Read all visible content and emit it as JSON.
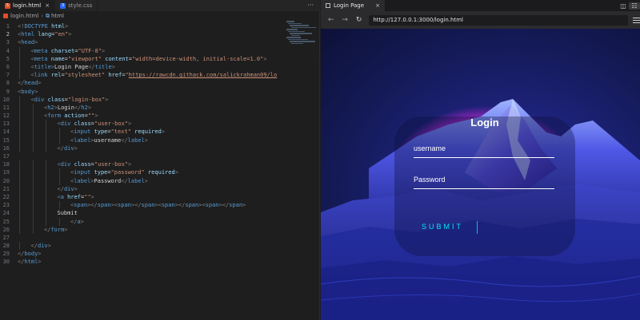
{
  "editor": {
    "tabs": [
      {
        "label": "login.html",
        "icon": "html-file-icon",
        "close": "×"
      },
      {
        "label": "style.css",
        "icon": "css-file-icon",
        "close": ""
      }
    ],
    "more": "···",
    "breadcrumb": {
      "file": "login.html",
      "separator": "›",
      "node": "html"
    },
    "current_line": 2,
    "lines": [
      {
        "n": "1",
        "indent": 0,
        "tokens": [
          [
            "br",
            "<!"
          ],
          [
            "tag",
            "DOCTYPE"
          ],
          [
            "text",
            " "
          ],
          [
            "attr",
            "html"
          ],
          [
            "br",
            ">"
          ]
        ]
      },
      {
        "n": "2",
        "indent": 0,
        "tokens": [
          [
            "br",
            "<"
          ],
          [
            "tag",
            "html"
          ],
          [
            "text",
            " "
          ],
          [
            "attr",
            "lang"
          ],
          [
            "text",
            "="
          ],
          [
            "str",
            "\"en\""
          ],
          [
            "br",
            ">"
          ]
        ]
      },
      {
        "n": "3",
        "indent": 0,
        "tokens": [
          [
            "br",
            "<"
          ],
          [
            "tag",
            "head"
          ],
          [
            "br",
            ">"
          ]
        ]
      },
      {
        "n": "4",
        "indent": 1,
        "tokens": [
          [
            "br",
            "<"
          ],
          [
            "tag",
            "meta"
          ],
          [
            "text",
            " "
          ],
          [
            "attr",
            "charset"
          ],
          [
            "text",
            "="
          ],
          [
            "str",
            "\"UTF-8\""
          ],
          [
            "br",
            ">"
          ]
        ]
      },
      {
        "n": "5",
        "indent": 1,
        "tokens": [
          [
            "br",
            "<"
          ],
          [
            "tag",
            "meta"
          ],
          [
            "text",
            " "
          ],
          [
            "attr",
            "name"
          ],
          [
            "text",
            "="
          ],
          [
            "str",
            "\"viewport\""
          ],
          [
            "text",
            " "
          ],
          [
            "attr",
            "content"
          ],
          [
            "text",
            "="
          ],
          [
            "str",
            "\"width=device-width, initial-scale=1.0\""
          ],
          [
            "br",
            ">"
          ]
        ]
      },
      {
        "n": "6",
        "indent": 1,
        "tokens": [
          [
            "br",
            "<"
          ],
          [
            "tag",
            "title"
          ],
          [
            "br",
            ">"
          ],
          [
            "text",
            "Login Page"
          ],
          [
            "br",
            "</"
          ],
          [
            "tag",
            "title"
          ],
          [
            "br",
            ">"
          ]
        ]
      },
      {
        "n": "7",
        "indent": 1,
        "tokens": [
          [
            "br",
            "<"
          ],
          [
            "tag",
            "link"
          ],
          [
            "text",
            " "
          ],
          [
            "attr",
            "rel"
          ],
          [
            "text",
            "="
          ],
          [
            "str",
            "\"stylesheet\""
          ],
          [
            "text",
            " "
          ],
          [
            "attr",
            "href"
          ],
          [
            "text",
            "="
          ],
          [
            "str",
            "\""
          ],
          [
            "url",
            "https://rawcdn.githack.com/salickrahman09/lo"
          ]
        ]
      },
      {
        "n": "8",
        "indent": 0,
        "tokens": [
          [
            "br",
            "</"
          ],
          [
            "tag",
            "head"
          ],
          [
            "br",
            ">"
          ]
        ]
      },
      {
        "n": "9",
        "indent": 0,
        "tokens": [
          [
            "br",
            "<"
          ],
          [
            "tag",
            "body"
          ],
          [
            "br",
            ">"
          ]
        ]
      },
      {
        "n": "10",
        "indent": 1,
        "tokens": [
          [
            "br",
            "<"
          ],
          [
            "tag",
            "div"
          ],
          [
            "text",
            " "
          ],
          [
            "attr",
            "class"
          ],
          [
            "text",
            "="
          ],
          [
            "str",
            "\"login-box\""
          ],
          [
            "br",
            ">"
          ]
        ]
      },
      {
        "n": "11",
        "indent": 2,
        "tokens": [
          [
            "br",
            "<"
          ],
          [
            "tag",
            "h2"
          ],
          [
            "br",
            ">"
          ],
          [
            "text",
            "Login"
          ],
          [
            "br",
            "</"
          ],
          [
            "tag",
            "h2"
          ],
          [
            "br",
            ">"
          ]
        ]
      },
      {
        "n": "12",
        "indent": 2,
        "tokens": [
          [
            "br",
            "<"
          ],
          [
            "tag",
            "form"
          ],
          [
            "text",
            " "
          ],
          [
            "attr",
            "action"
          ],
          [
            "text",
            "="
          ],
          [
            "str",
            "\"\""
          ],
          [
            "br",
            ">"
          ]
        ]
      },
      {
        "n": "13",
        "indent": 3,
        "tokens": [
          [
            "br",
            "<"
          ],
          [
            "tag",
            "div"
          ],
          [
            "text",
            " "
          ],
          [
            "attr",
            "class"
          ],
          [
            "text",
            "="
          ],
          [
            "str",
            "\"user-box\""
          ],
          [
            "br",
            ">"
          ]
        ]
      },
      {
        "n": "14",
        "indent": 4,
        "tokens": [
          [
            "br",
            "<"
          ],
          [
            "tag",
            "input"
          ],
          [
            "text",
            " "
          ],
          [
            "attr",
            "type"
          ],
          [
            "text",
            "="
          ],
          [
            "str",
            "\"text\""
          ],
          [
            "text",
            " "
          ],
          [
            "attr",
            "required"
          ],
          [
            "br",
            ">"
          ]
        ]
      },
      {
        "n": "15",
        "indent": 4,
        "tokens": [
          [
            "br",
            "<"
          ],
          [
            "tag",
            "label"
          ],
          [
            "br",
            ">"
          ],
          [
            "text",
            "username"
          ],
          [
            "br",
            "</"
          ],
          [
            "tag",
            "label"
          ],
          [
            "br",
            ">"
          ]
        ]
      },
      {
        "n": "16",
        "indent": 3,
        "tokens": [
          [
            "br",
            "</"
          ],
          [
            "tag",
            "div"
          ],
          [
            "br",
            ">"
          ]
        ]
      },
      {
        "n": "17",
        "indent": 0,
        "tokens": []
      },
      {
        "n": "18",
        "indent": 3,
        "tokens": [
          [
            "br",
            "<"
          ],
          [
            "tag",
            "div"
          ],
          [
            "text",
            " "
          ],
          [
            "attr",
            "class"
          ],
          [
            "text",
            "="
          ],
          [
            "str",
            "\"user-box\""
          ],
          [
            "br",
            ">"
          ]
        ]
      },
      {
        "n": "19",
        "indent": 4,
        "tokens": [
          [
            "br",
            "<"
          ],
          [
            "tag",
            "input"
          ],
          [
            "text",
            " "
          ],
          [
            "attr",
            "type"
          ],
          [
            "text",
            "="
          ],
          [
            "str",
            "\"password\""
          ],
          [
            "text",
            " "
          ],
          [
            "attr",
            "required"
          ],
          [
            "br",
            ">"
          ]
        ]
      },
      {
        "n": "20",
        "indent": 4,
        "tokens": [
          [
            "br",
            "<"
          ],
          [
            "tag",
            "label"
          ],
          [
            "br",
            ">"
          ],
          [
            "text",
            "Password"
          ],
          [
            "br",
            "</"
          ],
          [
            "tag",
            "label"
          ],
          [
            "br",
            ">"
          ]
        ]
      },
      {
        "n": "21",
        "indent": 3,
        "tokens": [
          [
            "br",
            "</"
          ],
          [
            "tag",
            "div"
          ],
          [
            "br",
            ">"
          ]
        ]
      },
      {
        "n": "22",
        "indent": 3,
        "tokens": [
          [
            "br",
            "<"
          ],
          [
            "tag",
            "a"
          ],
          [
            "text",
            " "
          ],
          [
            "attr",
            "href"
          ],
          [
            "text",
            "="
          ],
          [
            "str",
            "\"\""
          ],
          [
            "br",
            ">"
          ]
        ]
      },
      {
        "n": "23",
        "indent": 4,
        "tokens": [
          [
            "br",
            "<"
          ],
          [
            "tag",
            "span"
          ],
          [
            "br",
            "></"
          ],
          [
            "tag",
            "span"
          ],
          [
            "br",
            "><"
          ],
          [
            "tag",
            "span"
          ],
          [
            "br",
            "></"
          ],
          [
            "tag",
            "span"
          ],
          [
            "br",
            "><"
          ],
          [
            "tag",
            "span"
          ],
          [
            "br",
            "></"
          ],
          [
            "tag",
            "span"
          ],
          [
            "br",
            "><"
          ],
          [
            "tag",
            "span"
          ],
          [
            "br",
            "></"
          ],
          [
            "tag",
            "span"
          ],
          [
            "br",
            ">"
          ]
        ]
      },
      {
        "n": "24",
        "indent": 3,
        "tokens": [
          [
            "text",
            "Submit"
          ]
        ]
      },
      {
        "n": "25",
        "indent": 4,
        "tokens": [
          [
            "br",
            "</"
          ],
          [
            "tag",
            "a"
          ],
          [
            "br",
            ">"
          ]
        ]
      },
      {
        "n": "26",
        "indent": 2,
        "tokens": [
          [
            "br",
            "</"
          ],
          [
            "tag",
            "form"
          ],
          [
            "br",
            ">"
          ]
        ]
      },
      {
        "n": "27",
        "indent": 0,
        "tokens": []
      },
      {
        "n": "28",
        "indent": 1,
        "tokens": [
          [
            "br",
            "</"
          ],
          [
            "tag",
            "div"
          ],
          [
            "br",
            ">"
          ]
        ]
      },
      {
        "n": "29",
        "indent": 0,
        "tokens": [
          [
            "br",
            "</"
          ],
          [
            "tag",
            "body"
          ],
          [
            "br",
            ">"
          ]
        ]
      },
      {
        "n": "30",
        "indent": 0,
        "tokens": [
          [
            "br",
            "</"
          ],
          [
            "tag",
            "html"
          ],
          [
            "br",
            ">"
          ]
        ]
      }
    ]
  },
  "browser": {
    "tab_title": "Login Page",
    "tab_close": "×",
    "url": "http://127.0.0.1:3000/login.html",
    "nav": {
      "back": "←",
      "forward": "→",
      "reload": "↻"
    },
    "tools": {
      "split": "◫",
      "lock": "🔒"
    },
    "login": {
      "title": "Login",
      "username_label": "username",
      "password_label": "Password",
      "submit_label": "SUBMIT"
    },
    "colors": {
      "accent": "#03e9f4",
      "background": "#141a56",
      "glow": "#a020f0"
    }
  }
}
